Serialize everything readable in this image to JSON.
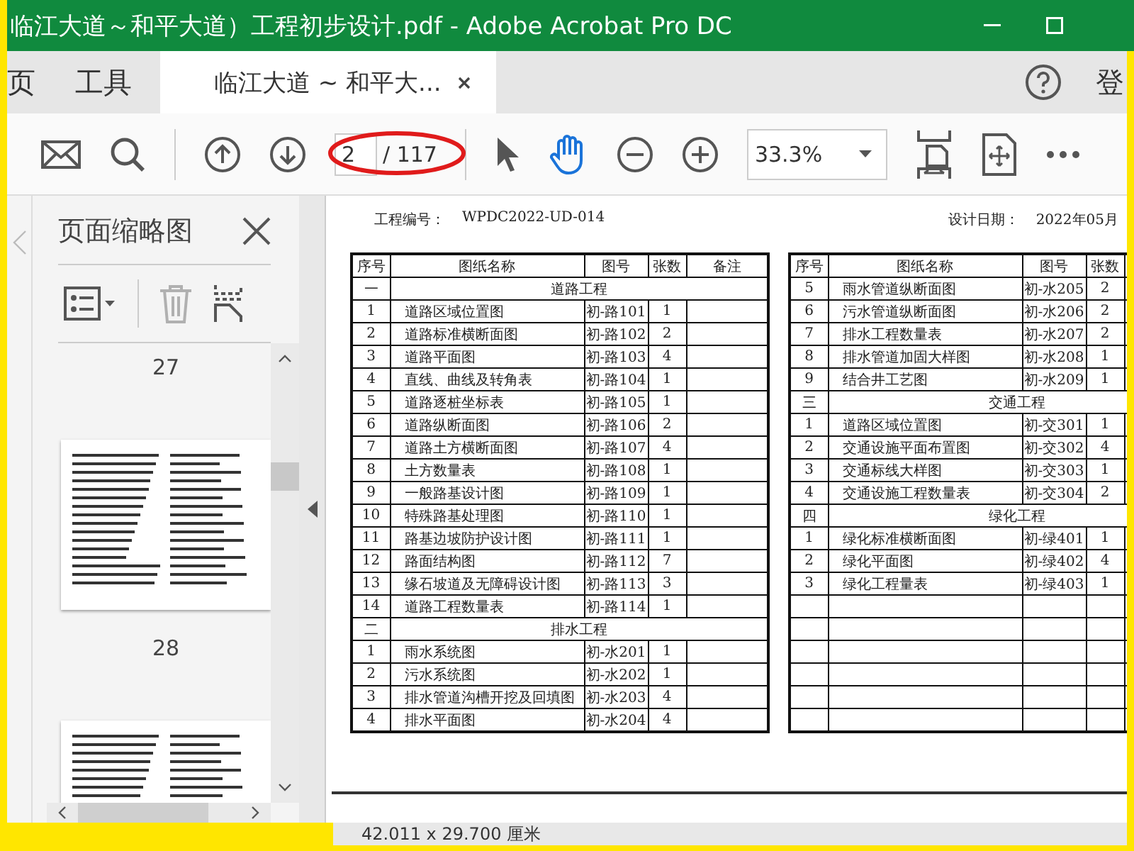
{
  "window": {
    "title": "临江大道～和平大道）工程初步设计.pdf - Adobe Acrobat Pro DC"
  },
  "tabs": [
    {
      "label": "页",
      "kind": "home",
      "selected": false
    },
    {
      "label": "工具",
      "kind": "home",
      "selected": false
    },
    {
      "label": "临江大道 ~ 和平大...",
      "kind": "document",
      "selected": true
    }
  ],
  "account_label": "登",
  "toolbar": {
    "page_number": "2",
    "page_total": "/ 117",
    "zoom": "33.3%"
  },
  "sidebar": {
    "title": "页面缩略图",
    "page_labels": [
      "27",
      "28"
    ]
  },
  "document": {
    "project_no_label": "工程编号：",
    "project_no": "WPDC2022-UD-014",
    "date_label": "设计日期：",
    "date": "2022年05月",
    "tables": [
      {
        "columns": [
          "序号",
          "图纸名称",
          "图号",
          "张数",
          "备注"
        ],
        "rows": [
          {
            "kind": "section",
            "no": "一",
            "title": "道路工程"
          },
          {
            "kind": "item",
            "no": "1",
            "name": "道路区域位置图",
            "code": "初-路101",
            "sheets": "1"
          },
          {
            "kind": "item",
            "no": "2",
            "name": "道路标准横断面图",
            "code": "初-路102",
            "sheets": "2"
          },
          {
            "kind": "item",
            "no": "3",
            "name": "道路平面图",
            "code": "初-路103",
            "sheets": "4"
          },
          {
            "kind": "item",
            "no": "4",
            "name": "直线、曲线及转角表",
            "code": "初-路104",
            "sheets": "1"
          },
          {
            "kind": "item",
            "no": "5",
            "name": "道路逐桩坐标表",
            "code": "初-路105",
            "sheets": "1"
          },
          {
            "kind": "item",
            "no": "6",
            "name": "道路纵断面图",
            "code": "初-路106",
            "sheets": "2"
          },
          {
            "kind": "item",
            "no": "7",
            "name": "道路土方横断面图",
            "code": "初-路107",
            "sheets": "4"
          },
          {
            "kind": "item",
            "no": "8",
            "name": "土方数量表",
            "code": "初-路108",
            "sheets": "1"
          },
          {
            "kind": "item",
            "no": "9",
            "name": "一般路基设计图",
            "code": "初-路109",
            "sheets": "1"
          },
          {
            "kind": "item",
            "no": "10",
            "name": "特殊路基处理图",
            "code": "初-路110",
            "sheets": "1"
          },
          {
            "kind": "item",
            "no": "11",
            "name": "路基边坡防护设计图",
            "code": "初-路111",
            "sheets": "1"
          },
          {
            "kind": "item",
            "no": "12",
            "name": "路面结构图",
            "code": "初-路112",
            "sheets": "7"
          },
          {
            "kind": "item",
            "no": "13",
            "name": "缘石坡道及无障碍设计图",
            "code": "初-路113",
            "sheets": "3"
          },
          {
            "kind": "item",
            "no": "14",
            "name": "道路工程数量表",
            "code": "初-路114",
            "sheets": "1"
          },
          {
            "kind": "section",
            "no": "二",
            "title": "排水工程"
          },
          {
            "kind": "item",
            "no": "1",
            "name": "雨水系统图",
            "code": "初-水201",
            "sheets": "1"
          },
          {
            "kind": "item",
            "no": "2",
            "name": "污水系统图",
            "code": "初-水202",
            "sheets": "1"
          },
          {
            "kind": "item",
            "no": "3",
            "name": "排水管道沟槽开挖及回填图",
            "code": "初-水203",
            "sheets": "4"
          },
          {
            "kind": "item",
            "no": "4",
            "name": "排水平面图",
            "code": "初-水204",
            "sheets": "4"
          }
        ]
      },
      {
        "columns": [
          "序号",
          "图纸名称",
          "图号",
          "张数"
        ],
        "rows": [
          {
            "kind": "item",
            "no": "5",
            "name": "雨水管道纵断面图",
            "code": "初-水205",
            "sheets": "2"
          },
          {
            "kind": "item",
            "no": "6",
            "name": "污水管道纵断面图",
            "code": "初-水206",
            "sheets": "2"
          },
          {
            "kind": "item",
            "no": "7",
            "name": "排水工程数量表",
            "code": "初-水207",
            "sheets": "2"
          },
          {
            "kind": "item",
            "no": "8",
            "name": "排水管道加固大样图",
            "code": "初-水208",
            "sheets": "1"
          },
          {
            "kind": "item",
            "no": "9",
            "name": "结合井工艺图",
            "code": "初-水209",
            "sheets": "1"
          },
          {
            "kind": "section",
            "no": "三",
            "title": "交通工程"
          },
          {
            "kind": "item",
            "no": "1",
            "name": "道路区域位置图",
            "code": "初-交301",
            "sheets": "1"
          },
          {
            "kind": "item",
            "no": "2",
            "name": "交通设施平面布置图",
            "code": "初-交302",
            "sheets": "4"
          },
          {
            "kind": "item",
            "no": "3",
            "name": "交通标线大样图",
            "code": "初-交303",
            "sheets": "1"
          },
          {
            "kind": "item",
            "no": "4",
            "name": "交通设施工程数量表",
            "code": "初-交304",
            "sheets": "2"
          },
          {
            "kind": "section",
            "no": "四",
            "title": "绿化工程"
          },
          {
            "kind": "item",
            "no": "1",
            "name": "绿化标准横断面图",
            "code": "初-绿401",
            "sheets": "1"
          },
          {
            "kind": "item",
            "no": "2",
            "name": "绿化平面图",
            "code": "初-绿402",
            "sheets": "4"
          },
          {
            "kind": "item",
            "no": "3",
            "name": "绿化工程量表",
            "code": "初-绿403",
            "sheets": "1"
          },
          {
            "kind": "empty"
          },
          {
            "kind": "empty"
          },
          {
            "kind": "empty"
          },
          {
            "kind": "empty"
          },
          {
            "kind": "empty"
          },
          {
            "kind": "empty"
          }
        ]
      }
    ]
  },
  "status_bar": {
    "page_size": "42.011 x 29.700 厘米"
  }
}
